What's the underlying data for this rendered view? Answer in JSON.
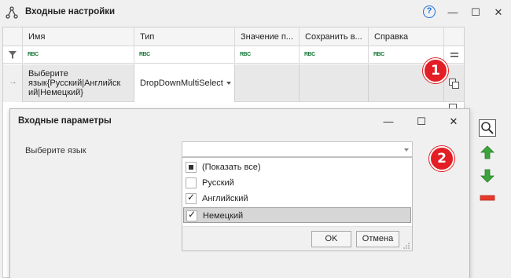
{
  "window": {
    "title": "Входные настройки",
    "help": "?",
    "minimize": "—",
    "maximize": "☐",
    "close": "✕"
  },
  "grid": {
    "columns": [
      "Имя",
      "Тип",
      "Значение п...",
      "Сохранить в...",
      "Справка"
    ],
    "filter_icon_text": "RBC",
    "row": {
      "name": "Выберите язык{Русский|Английск ий|Немецкий}",
      "type": "DropDownMultiSelect"
    }
  },
  "badges": [
    "1",
    "2"
  ],
  "dialog": {
    "title": "Входные параметры",
    "field_label": "Выберите язык",
    "combo_value": "",
    "options": [
      {
        "label": "(Показать все)",
        "state": "partial"
      },
      {
        "label": "Русский",
        "state": "unchecked"
      },
      {
        "label": "Английский",
        "state": "checked"
      },
      {
        "label": "Немецкий",
        "state": "checked"
      }
    ],
    "ok": "OK",
    "cancel": "Отмена"
  },
  "colors": {
    "badge": "#e31e24",
    "add": "#3aa53a",
    "remove": "#e8392b",
    "help": "#1e6fd9"
  }
}
